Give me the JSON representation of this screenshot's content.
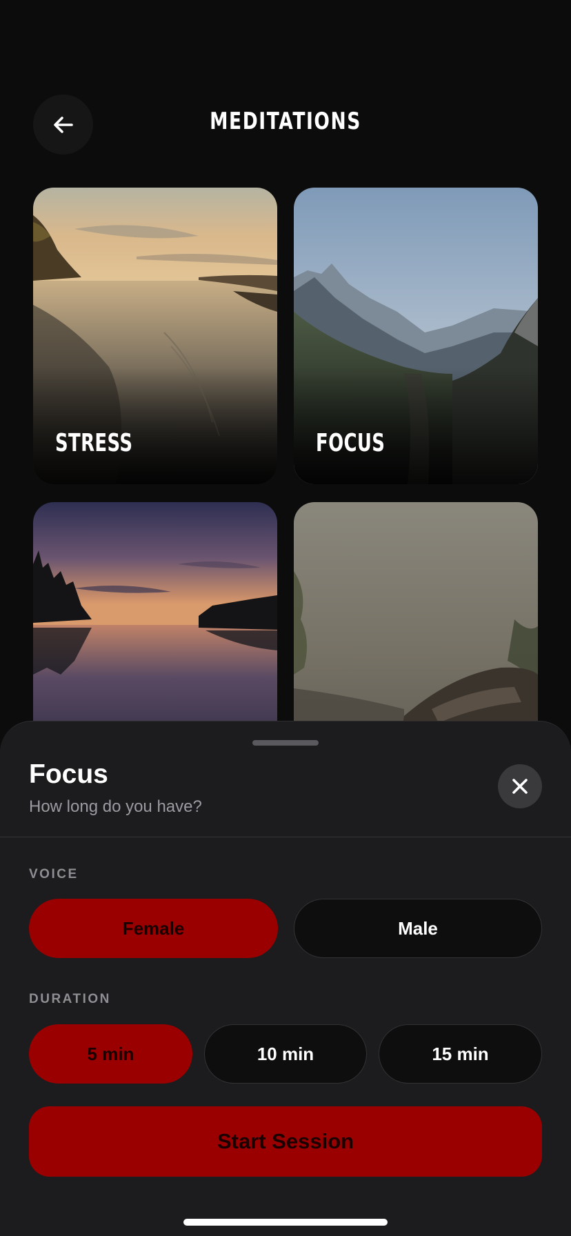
{
  "header": {
    "title": "MEDITATIONS",
    "back_icon": "arrow-left-icon"
  },
  "cards": [
    {
      "id": "stress",
      "label": "STRESS",
      "scene": "sunrise lake shoreline"
    },
    {
      "id": "focus",
      "label": "FOCUS",
      "scene": "mountain valley path"
    },
    {
      "id": "sunset",
      "label": "",
      "scene": "forest lake at dusk"
    },
    {
      "id": "fog",
      "label": "",
      "scene": "foggy cliff"
    }
  ],
  "sheet": {
    "title": "Focus",
    "subtitle": "How long do you have?",
    "close_icon": "close-icon",
    "voice": {
      "label": "VOICE",
      "options": [
        "Female",
        "Male"
      ],
      "selected": "Female"
    },
    "duration": {
      "label": "DURATION",
      "options": [
        "5 min",
        "10 min",
        "15 min"
      ],
      "selected": "5 min"
    },
    "start_label": "Start Session"
  },
  "colors": {
    "accent": "#9b0000",
    "background": "#0c0c0d",
    "sheet": "#1c1c1e"
  }
}
